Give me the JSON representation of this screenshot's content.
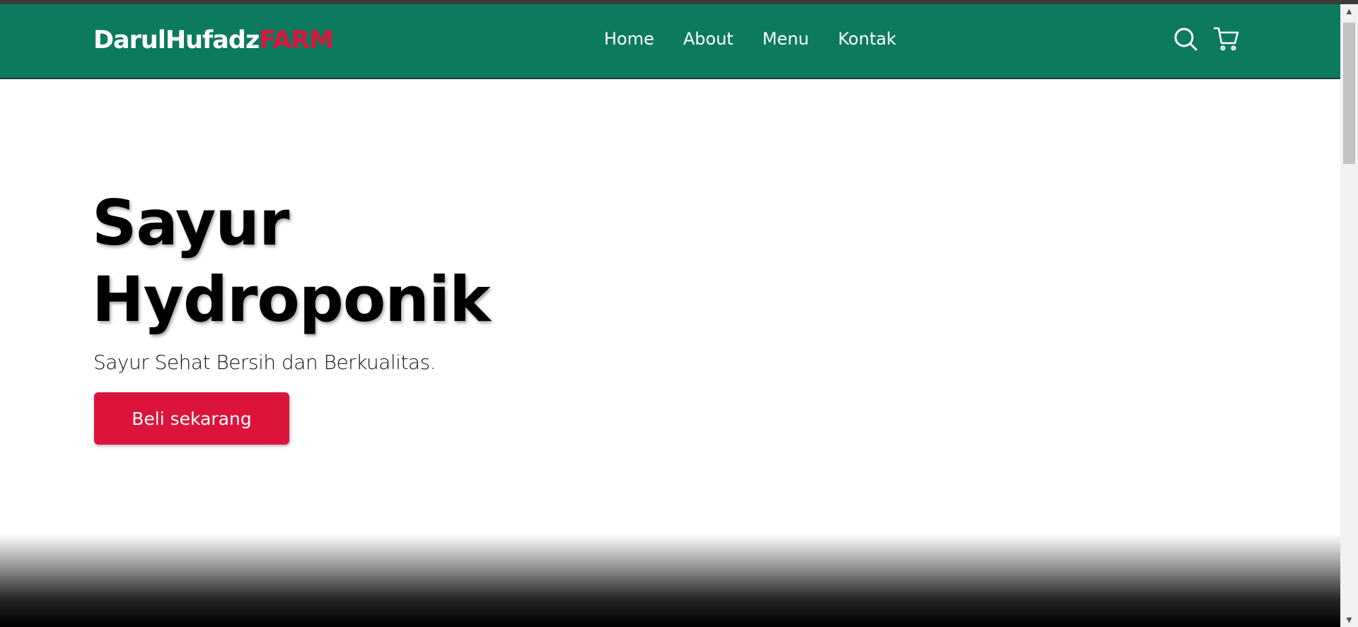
{
  "brand": {
    "name_primary": "DarulHufadz",
    "name_accent": "FARM"
  },
  "nav": {
    "links": [
      "Home",
      "About",
      "Menu",
      "Kontak"
    ],
    "icons": [
      "search-icon",
      "cart-icon"
    ]
  },
  "hero": {
    "title_line1": "Sayur",
    "title_line2": "Hydroponik",
    "subtitle": "Sayur Sehat Bersih dan Berkualitas.",
    "cta_label": "Beli sekarang"
  },
  "scrollbar": {
    "up_arrow": "▲",
    "down_arrow": "▼"
  },
  "colors": {
    "navbar": "#0c7a5f",
    "accent": "#dc143c",
    "text": "#000000"
  }
}
